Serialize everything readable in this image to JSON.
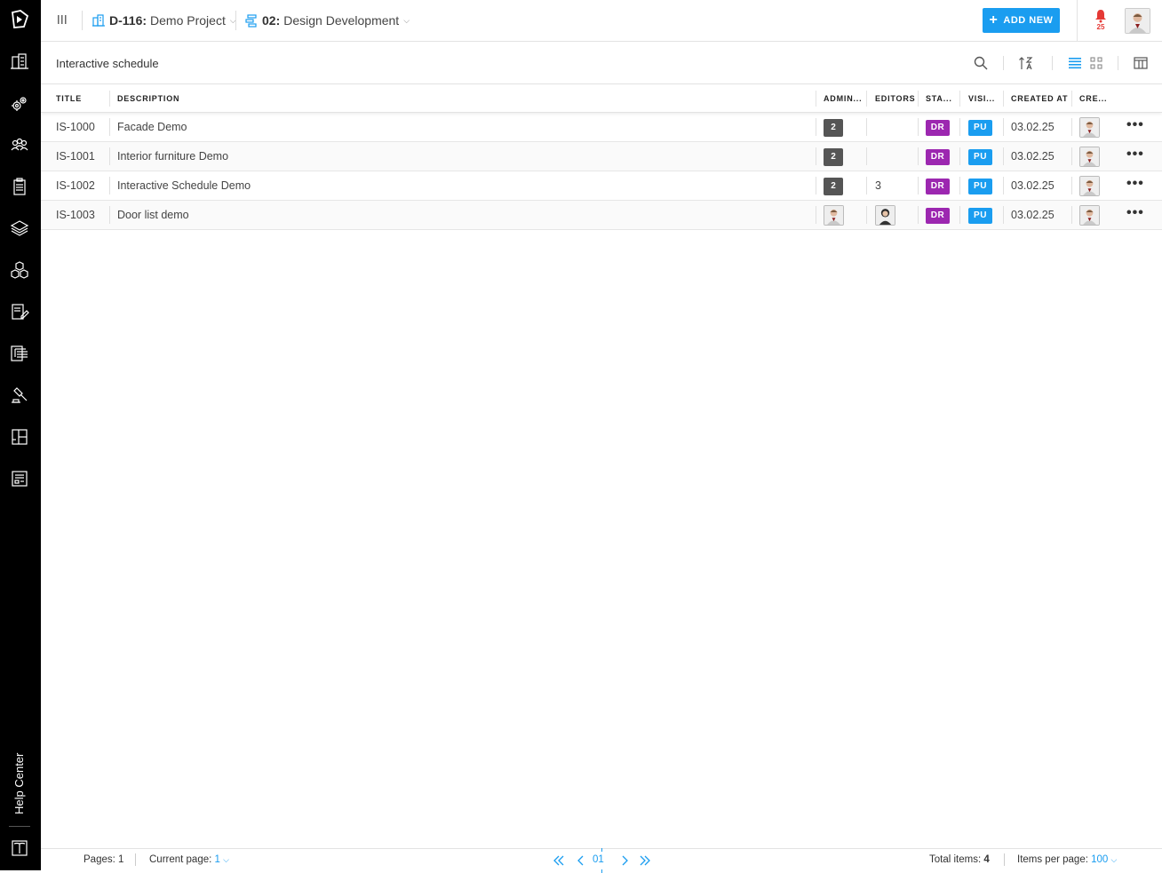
{
  "sidebar": {
    "logo": "app-logo",
    "items": [
      {
        "icon": "buildings-icon"
      },
      {
        "icon": "settings-gears-icon"
      },
      {
        "icon": "team-icon"
      },
      {
        "icon": "clipboard-icon"
      },
      {
        "icon": "layers-icon"
      },
      {
        "icon": "cubes-icon"
      },
      {
        "icon": "document-edit-icon"
      },
      {
        "icon": "tree-list-icon"
      },
      {
        "icon": "gavel-icon"
      },
      {
        "icon": "floorplan-icon"
      },
      {
        "icon": "report-icon"
      }
    ],
    "help_label": "Help Center"
  },
  "topbar": {
    "project_code": "D-116:",
    "project_name": "Demo Project",
    "phase_code": "02:",
    "phase_name": "Design Development",
    "add_new_label": "ADD NEW",
    "notification_count": "25"
  },
  "toolbar": {
    "title": "Interactive schedule"
  },
  "table": {
    "headers": {
      "title": "TITLE",
      "description": "DESCRIPTION",
      "admins": "ADMIN...",
      "editors": "EDITORS",
      "status": "STA...",
      "visibility": "VISI...",
      "created_at": "CREATED AT",
      "created_by": "CRE..."
    },
    "rows": [
      {
        "title": "IS-1000",
        "description": "Facade Demo",
        "admins": "2",
        "editors": "",
        "status": "DR",
        "visibility": "PU",
        "created_at": "03.02.25"
      },
      {
        "title": "IS-1001",
        "description": "Interior furniture Demo",
        "admins": "2",
        "editors": "",
        "status": "DR",
        "visibility": "PU",
        "created_at": "03.02.25"
      },
      {
        "title": "IS-1002",
        "description": "Interactive Schedule Demo",
        "admins": "2",
        "editors": "3",
        "status": "DR",
        "visibility": "PU",
        "created_at": "03.02.25"
      },
      {
        "title": "IS-1003",
        "description": "Door list demo",
        "admins": "",
        "editors": "",
        "status": "DR",
        "visibility": "PU",
        "created_at": "03.02.25"
      }
    ],
    "more_label": "•••"
  },
  "footer": {
    "pages_label": "Pages:",
    "pages_value": "1",
    "current_page_label": "Current page:",
    "current_page_value": "1",
    "pager_current": "01",
    "total_items_label": "Total items:",
    "total_items_value": "4",
    "items_per_page_label": "Items per page:",
    "items_per_page_value": "100"
  },
  "colors": {
    "accent": "#1a9df0",
    "draft": "#9c27b0",
    "notification": "#e53935",
    "sidebar": "#000000"
  }
}
